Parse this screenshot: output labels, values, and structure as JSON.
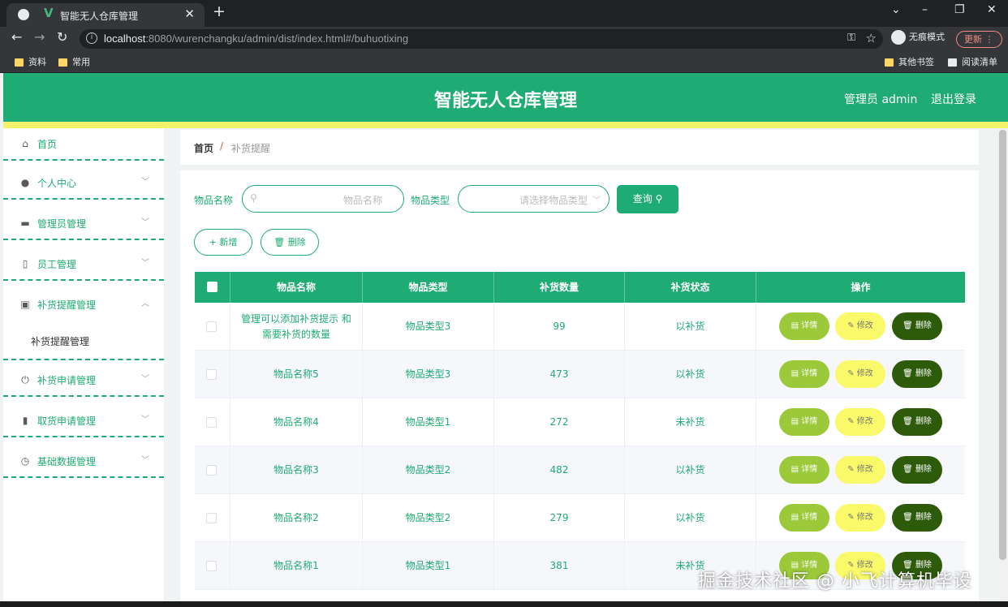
{
  "browser": {
    "tab_title": "智能无人仓库管理",
    "tab_icon": "V",
    "url_host": "localhost",
    "url_rest": ":8080/wurenchangku/admin/dist/index.html#/buhuotixing",
    "incognito_label": "无痕模式",
    "update_label": "更新",
    "bookmarks": [
      "资料",
      "常用"
    ],
    "bookmarks_right": [
      "其他书签",
      "阅读清单"
    ]
  },
  "header": {
    "title": "智能无人仓库管理",
    "user_label": "管理员 admin",
    "logout_label": "退出登录"
  },
  "sidebar": {
    "items": [
      {
        "label": "首页",
        "icon": "home-icon"
      },
      {
        "label": "个人中心",
        "icon": "user-icon"
      },
      {
        "label": "管理员管理",
        "icon": "ticket-icon"
      },
      {
        "label": "员工管理",
        "icon": "microphone-icon"
      },
      {
        "label": "补货提醒管理",
        "icon": "clipboard-icon"
      },
      {
        "label": "补货申请管理",
        "icon": "power-icon"
      },
      {
        "label": "取货申请管理",
        "icon": "bar-chart-icon"
      },
      {
        "label": "基础数据管理",
        "icon": "clock-icon"
      }
    ],
    "submenu_label": "补货提醒管理"
  },
  "breadcrumb": {
    "home": "首页",
    "separator": "/",
    "current": "补货提醒"
  },
  "search": {
    "name_label": "物品名称",
    "name_placeholder": "物品名称",
    "type_label": "物品类型",
    "type_placeholder": "请选择物品类型",
    "query_button": "查询 ⚲"
  },
  "actions": {
    "add": "+ 新增",
    "delete": "🗑 删除"
  },
  "table": {
    "headers": [
      "物品名称",
      "物品类型",
      "补货数量",
      "补货状态",
      "操作"
    ],
    "op_labels": {
      "detail": "▤ 详情",
      "edit": "✎ 修改",
      "delete": "🗑 删除"
    },
    "rows": [
      {
        "name": "管理可以添加补货提示 和需要补货的数量",
        "type": "物品类型3",
        "qty": "99",
        "status": "以补货"
      },
      {
        "name": "物品名称5",
        "type": "物品类型3",
        "qty": "473",
        "status": "以补货"
      },
      {
        "name": "物品名称4",
        "type": "物品类型1",
        "qty": "272",
        "status": "未补货"
      },
      {
        "name": "物品名称3",
        "type": "物品类型2",
        "qty": "482",
        "status": "以补货"
      },
      {
        "name": "物品名称2",
        "type": "物品类型2",
        "qty": "279",
        "status": "以补货"
      },
      {
        "name": "物品名称1",
        "type": "物品类型1",
        "qty": "381",
        "status": "未补货"
      }
    ]
  },
  "watermark": "掘金技术社区 @ 小飞计算机毕设",
  "colors": {
    "brand": "#1eab74",
    "yellow": "#f3f36b",
    "detail": "#9bc93a",
    "edit": "#f9f96a",
    "delete": "#2d5b0a"
  }
}
